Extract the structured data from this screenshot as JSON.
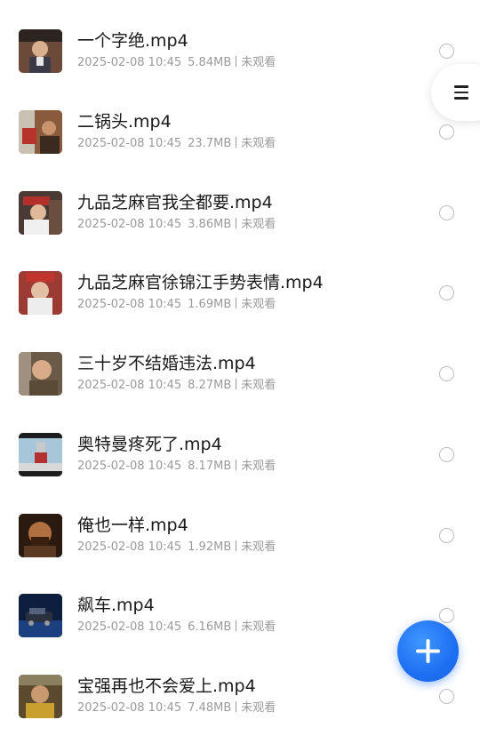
{
  "videos": [
    {
      "title": "一个字绝.mp4",
      "date": "2025-02-08 10:45",
      "size": "5.84MB",
      "status": "未观看",
      "thumb_color": "#6b4a3a"
    },
    {
      "title": "二锅头.mp4",
      "date": "2025-02-08 10:45",
      "size": "23.7MB",
      "status": "未观看",
      "thumb_color": "#8a5a3c"
    },
    {
      "title": "九品芝麻官我全都要.mp4",
      "date": "2025-02-08 10:45",
      "size": "3.86MB",
      "status": "未观看",
      "thumb_color": "#8b2f2a"
    },
    {
      "title": "九品芝麻官徐锦江手势表情.mp4",
      "date": "2025-02-08 10:45",
      "size": "1.69MB",
      "status": "未观看",
      "thumb_color": "#9b3b34"
    },
    {
      "title": "三十岁不结婚违法.mp4",
      "date": "2025-02-08 10:45",
      "size": "8.27MB",
      "status": "未观看",
      "thumb_color": "#6b5a48"
    },
    {
      "title": "奥特曼疼死了.mp4",
      "date": "2025-02-08 10:45",
      "size": "8.17MB",
      "status": "未观看",
      "thumb_color": "#7fa6c2"
    },
    {
      "title": "俺也一样.mp4",
      "date": "2025-02-08 10:45",
      "size": "1.92MB",
      "status": "未观看",
      "thumb_color": "#5a3a22"
    },
    {
      "title": "飙车.mp4",
      "date": "2025-02-08 10:45",
      "size": "6.16MB",
      "status": "未观看",
      "thumb_color": "#1c3f80"
    },
    {
      "title": "宝强再也不会爱上.mp4",
      "date": "2025-02-08 10:45",
      "size": "7.48MB",
      "status": "未观看",
      "thumb_color": "#5b4a2e"
    }
  ],
  "icons": {
    "menu": "menu-icon",
    "add": "plus-icon",
    "select": "radio-circle-icon"
  },
  "colors": {
    "accent": "#1f6ff2",
    "title_text": "#1a1a1a",
    "meta_text": "#9a9a9a"
  }
}
